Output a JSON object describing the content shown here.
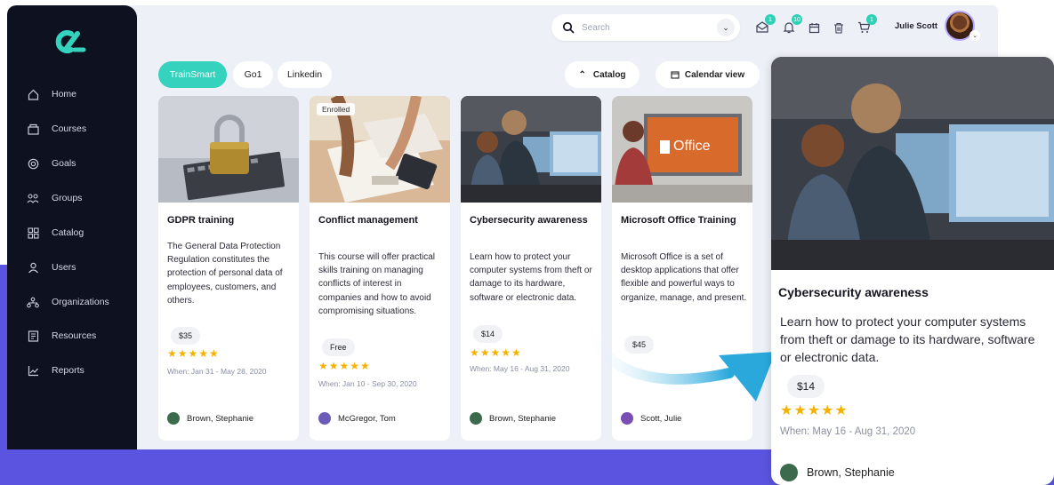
{
  "colors": {
    "accent": "#35d2bd",
    "sidebar": "#0e1120",
    "band": "#5b54e0",
    "star": "#f5b300"
  },
  "sidebar": {
    "logo_icon": "logo-icon",
    "items": [
      {
        "label": "Home",
        "icon": "home-icon"
      },
      {
        "label": "Courses",
        "icon": "courses-icon"
      },
      {
        "label": "Goals",
        "icon": "goals-icon"
      },
      {
        "label": "Groups",
        "icon": "groups-icon"
      },
      {
        "label": "Catalog",
        "icon": "catalog-icon"
      },
      {
        "label": "Users",
        "icon": "users-icon"
      },
      {
        "label": "Organizations",
        "icon": "organizations-icon"
      },
      {
        "label": "Resources",
        "icon": "resources-icon"
      },
      {
        "label": "Reports",
        "icon": "reports-icon"
      }
    ]
  },
  "header": {
    "search_placeholder": "Search",
    "badges": {
      "messages": "1",
      "notifications": "10",
      "cart": "1"
    },
    "user_name": "Julie Scott"
  },
  "tabs": [
    {
      "label": "TrainSmart",
      "active": true
    },
    {
      "label": "Go1",
      "active": false
    },
    {
      "label": "Linkedin",
      "active": false
    }
  ],
  "toolbar": {
    "catalog_label": "Catalog",
    "calendar_label": "Calendar view"
  },
  "cards": [
    {
      "title": "GDPR training",
      "description": "The General Data Protection Regulation constitutes the protection of personal data of employees, customers, and others.",
      "price": "$35",
      "rating": 5,
      "stars": "★★★★★",
      "when": "When: Jan 31 - May 28, 2020",
      "author": "Brown, Stephanie"
    },
    {
      "title": "Conflict management",
      "badge": "Enrolled",
      "description": "This course will offer practical skills training on managing conflicts of interest in companies and how to avoid compromising situations.",
      "price": "Free",
      "rating": 5,
      "stars": "★★★★★",
      "when": "When: Jan 10 - Sep 30, 2020",
      "author": "McGregor, Tom"
    },
    {
      "title": "Cybersecurity awareness",
      "description": "Learn how to protect your computer systems from theft or damage to its hardware, software or electronic data.",
      "price": "$14",
      "rating": 5,
      "stars": "★★★★★",
      "when": "When: May 16 - Aug 31, 2020",
      "author": "Brown, Stephanie"
    },
    {
      "title": "Microsoft Office Training",
      "image_text": "Office",
      "description": "Microsoft Office is a set of desktop applications that offer flexible and powerful ways to organize, manage, and present.",
      "price": "$45",
      "author": "Scott, Julie"
    }
  ],
  "zoomed_card": {
    "title": "Cybersecurity awareness",
    "description": "Learn how to protect your computer systems from theft or damage to its hardware, software or electronic data.",
    "price": "$14",
    "rating": 5,
    "stars": "★★★★★",
    "when": "When: May 16 - Aug 31, 2020",
    "author": "Brown, Stephanie"
  }
}
